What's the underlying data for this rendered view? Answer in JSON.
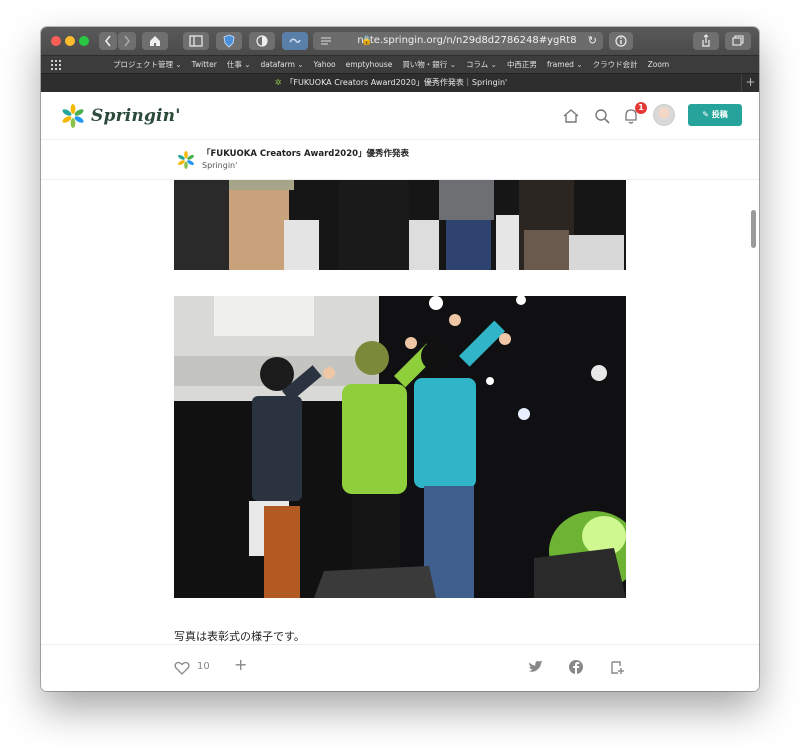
{
  "browser": {
    "url": "note.springin.org/n/n29d8d2786248#ygRt8",
    "tab_title": "「FUKUOKA Creators Award2020」優秀作発表｜Springin'",
    "bookmarks": [
      "プロジェクト管理 ⌄",
      "Twitter",
      "仕事 ⌄",
      "datafarm ⌄",
      "Yahoo",
      "emptyhouse",
      "買い物・銀行 ⌄",
      "コラム ⌄",
      "中西正男",
      "framed ⌄",
      "クラウド会計",
      "Zoom"
    ]
  },
  "header": {
    "logo_text": "Springin'",
    "notification_count": "1",
    "post_label": "投稿"
  },
  "magazine": {
    "title": "「FUKUOKA Creators Award2020」優秀作発表",
    "author": "Springin'"
  },
  "article": {
    "caption": "写真は表彰式の様子です。"
  },
  "footer": {
    "like_count": "10"
  },
  "colors": {
    "accent": "#26a49b",
    "badge": "#e53935"
  }
}
